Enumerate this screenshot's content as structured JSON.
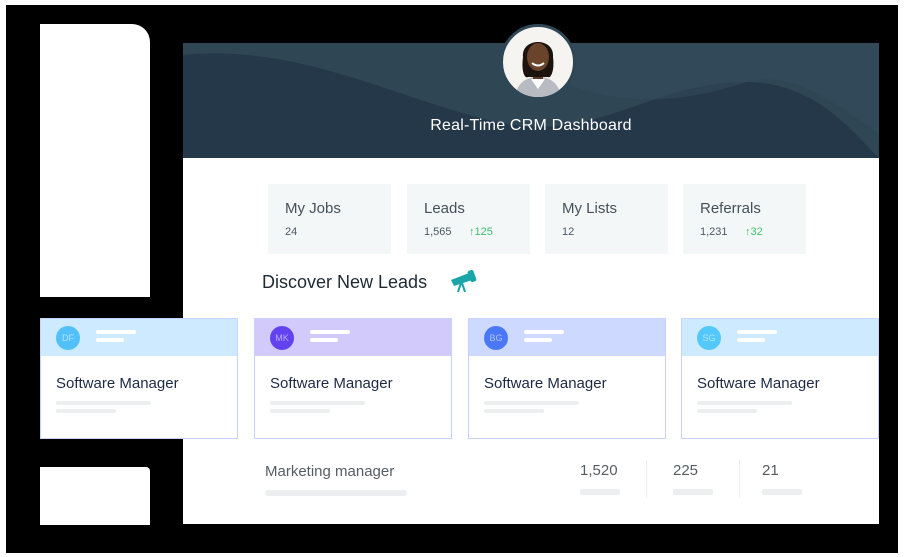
{
  "header": {
    "title": "Real-Time CRM Dashboard",
    "bg_color": "#2f4655"
  },
  "stats": [
    {
      "label": "My Jobs",
      "value": "24",
      "delta": ""
    },
    {
      "label": "Leads",
      "value": "1,565",
      "delta": "125"
    },
    {
      "label": "My Lists",
      "value": "12",
      "delta": ""
    },
    {
      "label": "Referrals",
      "value": "1,231",
      "delta": "32"
    }
  ],
  "delta_color": "#3cc36a",
  "discover": {
    "title": "Discover New Leads",
    "icon": "telescope-icon"
  },
  "cards": [
    {
      "initials": "DF",
      "title": "Software Manager",
      "strip_color": "#cdeafe",
      "avatar_color": "#52c0f9"
    },
    {
      "initials": "MK",
      "title": "Software Manager",
      "strip_color": "#d1cafa",
      "avatar_color": "#6342f0"
    },
    {
      "initials": "BG",
      "title": "Software Manager",
      "strip_color": "#cdd9fe",
      "avatar_color": "#4a78f6"
    },
    {
      "initials": "SG",
      "title": "Software Manager",
      "strip_color": "#cdeafe",
      "avatar_color": "#52c8fb"
    }
  ],
  "bottom_row": {
    "label": "Marketing manager",
    "values": [
      "1,520",
      "225",
      "21"
    ]
  }
}
